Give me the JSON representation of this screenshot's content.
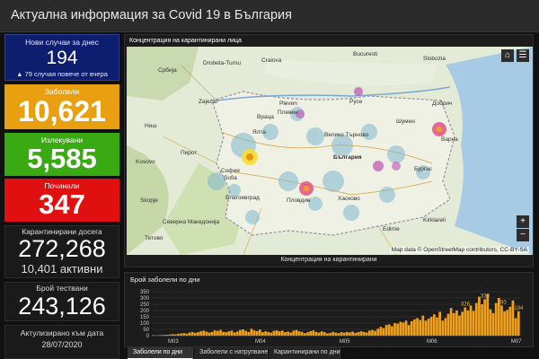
{
  "header": {
    "title": "Актуална информация за Covid 19 в България"
  },
  "cards": {
    "new_cases": {
      "label": "Нови случаи за днес",
      "value": "194",
      "note": "▲ 79 случая повече от вчера"
    },
    "cases": {
      "label": "Заболели",
      "value": "10,621",
      "color": "#e8a010"
    },
    "recovered": {
      "label": "Излекувани",
      "value": "5,585",
      "color": "#3aaa12"
    },
    "deaths": {
      "label": "Починали",
      "value": "347",
      "color": "#e01010"
    },
    "quarantine": {
      "label": "Карантинирани досега",
      "value": "272,268",
      "active": "10,401 активни"
    },
    "tests": {
      "label": "Брой тествани",
      "value": "243,126"
    },
    "updated": {
      "label": "Актулизирано към дата",
      "date": "28/07/2020"
    }
  },
  "map": {
    "title": "Концентрация на карантинирани лица",
    "footer": "Концентрация на карантинирани",
    "attribution": "Map data © OpenStreetMap contributors, CC-BY-SA",
    "zoom_in": "+",
    "zoom_out": "−",
    "home_icon": "home-icon",
    "list_icon": "list-icon",
    "labels": [
      "Србија",
      "Bucuresti",
      "България",
      "Pleven",
      "Плевен",
      "Враца",
      "Русе",
      "Велико Търново",
      "Шумен",
      "Варна",
      "Добрич",
      "Sofia",
      "София",
      "Пловдив",
      "Kosovo",
      "Северна Македонија",
      "Благоевград",
      "Бургас",
      "Хасково",
      "Edirne",
      "Kirklareli",
      "Skopje",
      "Тетово",
      "Пирот",
      "Zaječar",
      "Ниш",
      "Drobeta-Turnu",
      "Craiova",
      "Slobozia",
      "Ялта"
    ],
    "hotspots": [
      {
        "name": "София",
        "intensity": 1.0
      },
      {
        "name": "Пловдив",
        "intensity": 0.85
      },
      {
        "name": "Варна",
        "intensity": 0.8
      },
      {
        "name": "Русе",
        "intensity": 0.55
      },
      {
        "name": "Бургас",
        "intensity": 0.5
      },
      {
        "name": "Стара Загора",
        "intensity": 0.45
      },
      {
        "name": "Плевен",
        "intensity": 0.4
      }
    ]
  },
  "chart_data": {
    "type": "bar",
    "title": "Брой заболели по дни",
    "x_ticks": [
      "M03",
      "M04",
      "M05",
      "M06",
      "M07"
    ],
    "ylim": [
      0,
      400
    ],
    "y_ticks": [
      0,
      50,
      100,
      150,
      200,
      250,
      300,
      350
    ],
    "start_label": "M03",
    "values": [
      4,
      2,
      3,
      5,
      6,
      7,
      9,
      12,
      10,
      15,
      18,
      20,
      16,
      25,
      30,
      22,
      28,
      35,
      40,
      32,
      25,
      30,
      42,
      38,
      45,
      30,
      28,
      35,
      40,
      26,
      33,
      45,
      50,
      38,
      30,
      55,
      42,
      36,
      48,
      28,
      35,
      30,
      25,
      38,
      42,
      35,
      40,
      28,
      32,
      25,
      40,
      45,
      35,
      30,
      20,
      28,
      36,
      42,
      30,
      25,
      35,
      28,
      18,
      22,
      30,
      25,
      20,
      28,
      24,
      30,
      26,
      32,
      22,
      28,
      35,
      30,
      25,
      40,
      45,
      38,
      55,
      70,
      60,
      85,
      90,
      75,
      100,
      95,
      110,
      105,
      120,
      85,
      115,
      130,
      140,
      125,
      160,
      120,
      135,
      150,
      170,
      145,
      190,
      120,
      140,
      175,
      220,
      180,
      200,
      160,
      190,
      225,
      200,
      240,
      198,
      260,
      310,
      250,
      290,
      330,
      210,
      180,
      260,
      300,
      240,
      194,
      205,
      230,
      280,
      140,
      194
    ],
    "data_labels": [
      {
        "index": 111,
        "text": "326"
      },
      {
        "index": 118,
        "text": "330"
      },
      {
        "index": 124,
        "text": "260"
      },
      {
        "index": 130,
        "text": "194"
      }
    ]
  },
  "tabs": [
    "Заболели по дни",
    "Заболели с натрупване",
    "Карантинирани по дни"
  ]
}
